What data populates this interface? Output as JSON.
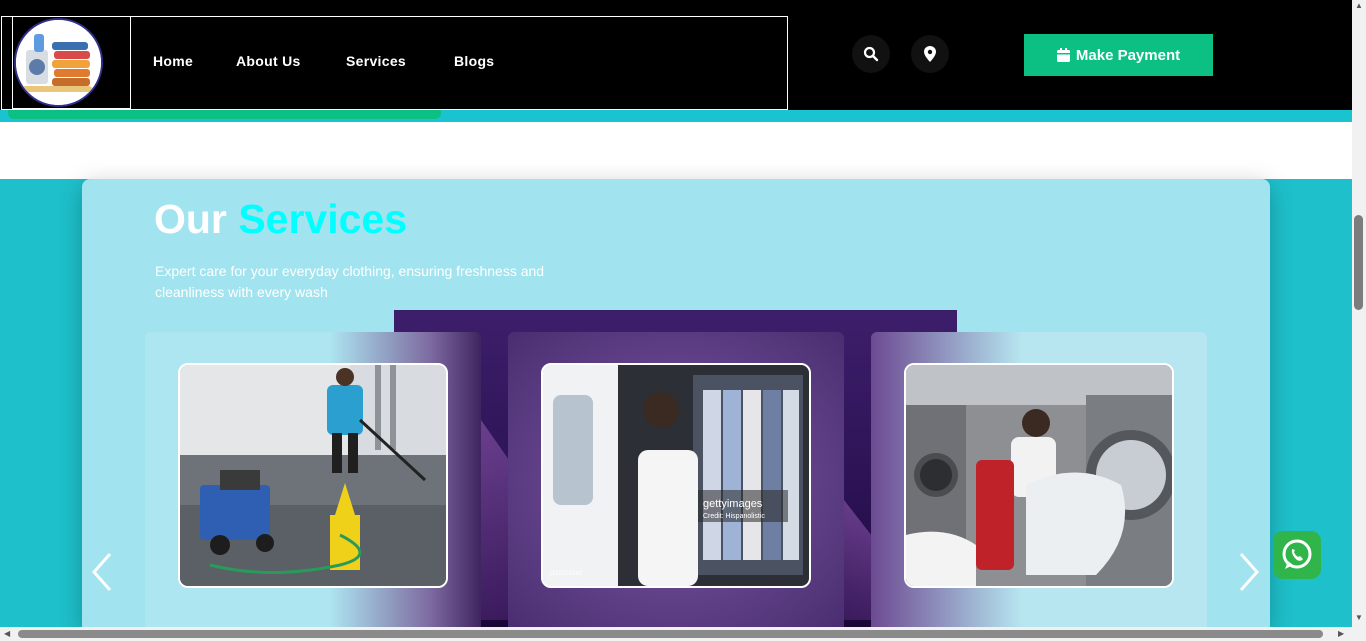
{
  "header": {
    "nav": [
      "Home",
      "About Us",
      "Services",
      "Blogs"
    ],
    "logo_icon": "laundry-logo",
    "search_icon": "search-icon",
    "location_icon": "map-pin-icon",
    "pay_button": {
      "icon": "calendar-icon",
      "label": "Make Payment"
    }
  },
  "progress": {
    "value": 0.32,
    "fill_color": "#0cc083",
    "track_color": "#19c3cf"
  },
  "section": {
    "title_main": "Our",
    "title_accent": "Services",
    "description": "Expert care for your everyday clothing, ensuring freshness and cleanliness with every wash"
  },
  "cards": [
    {
      "image": "pressure-washing-photo"
    },
    {
      "image": "dry-cleaning-delivery-photo",
      "watermark": "gettyimages",
      "watermark_credit": "Credit: Hispanolistic",
      "watermark_id": "1132074242"
    },
    {
      "image": "industrial-laundry-photo"
    }
  ],
  "carousel": {
    "prev_icon": "chevron-left-icon",
    "next_icon": "chevron-right-icon"
  },
  "whatsapp_icon": "whatsapp-icon",
  "colors": {
    "brand_green": "#0cc083",
    "teal": "#1ec0cb",
    "accent_cyan": "#00ffff",
    "panel": "#a1e3ee"
  }
}
